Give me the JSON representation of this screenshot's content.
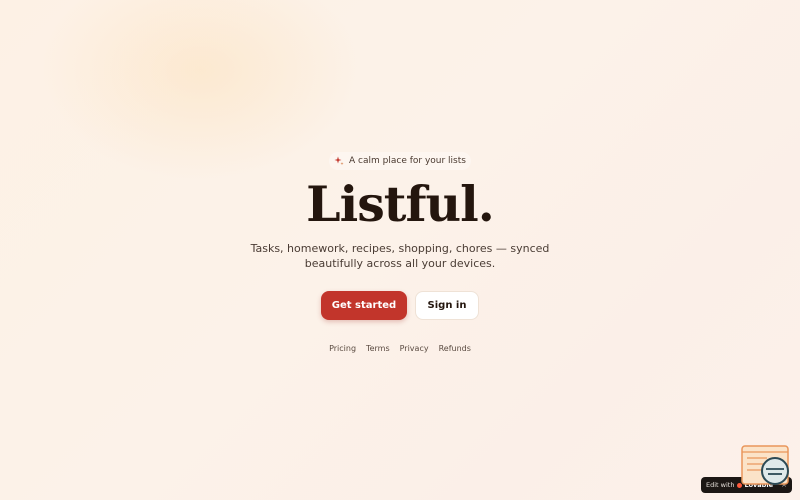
{
  "hero": {
    "tagline": "A calm place for your lists",
    "title": "Listful.",
    "subtitle": "Tasks, homework, recipes, shopping, chores — synced beautifully across all your devices.",
    "primary_cta": "Get started",
    "secondary_cta": "Sign in"
  },
  "footer": {
    "links": [
      "Pricing",
      "Terms",
      "Privacy",
      "Refunds"
    ]
  },
  "edit_badge": {
    "prefix": "Edit with",
    "brand": "Lovable",
    "close": "×"
  },
  "icons": {
    "tagline": "sparkle-icon",
    "widget": "notes-widget-icon"
  },
  "colors": {
    "accent": "#c2352b",
    "title": "#24160e",
    "background": "#fcf2e9"
  }
}
